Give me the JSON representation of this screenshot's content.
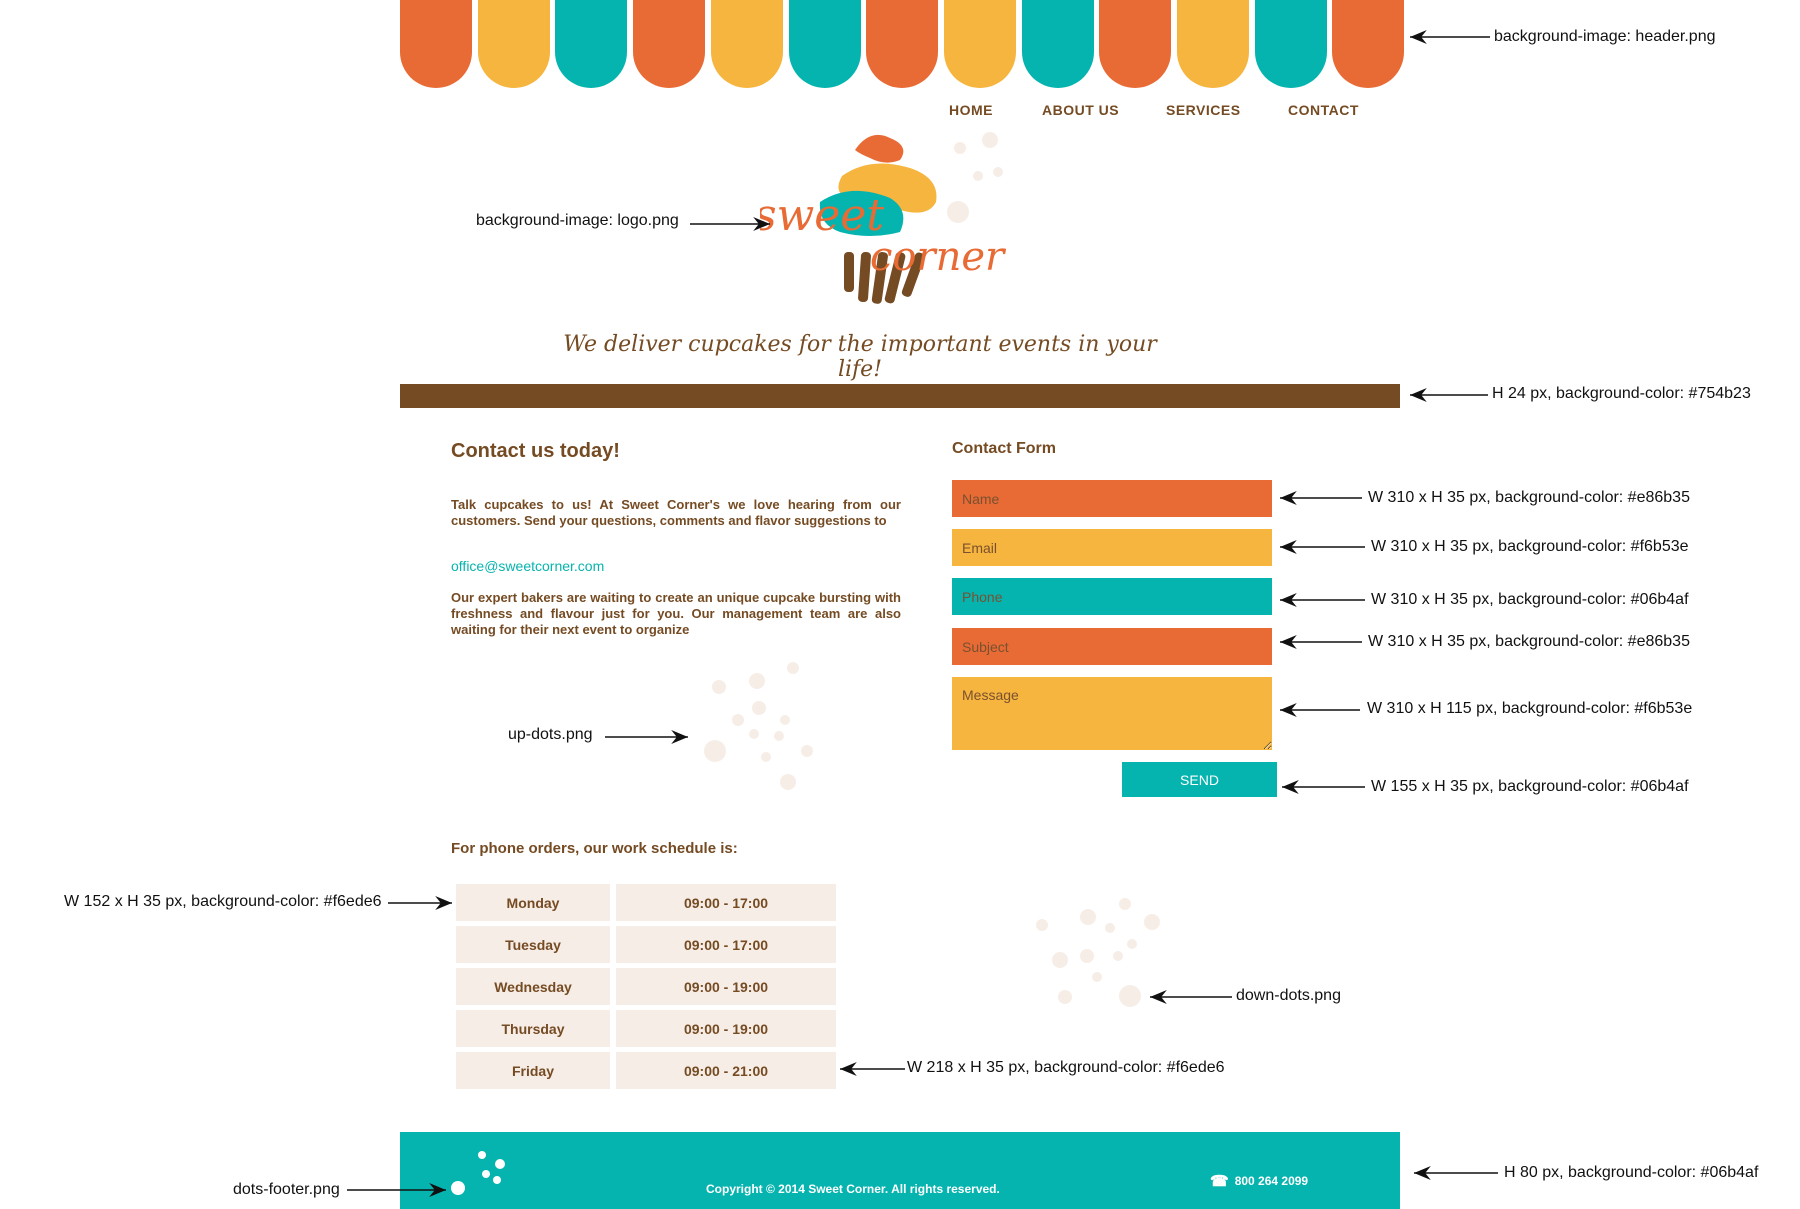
{
  "header": {
    "stripe_colors": [
      "#e86b35",
      "#f6b53e",
      "#06b4af",
      "#e86b35",
      "#f6b53e",
      "#06b4af",
      "#e86b35",
      "#f6b53e",
      "#06b4af",
      "#e86b35",
      "#f6b53e",
      "#06b4af",
      "#e86b35"
    ]
  },
  "nav": {
    "home": "HOME",
    "about": "ABOUT US",
    "services": "SERVICES",
    "contact": "CONTACT"
  },
  "logo": {
    "line1": "sweet",
    "line2": "corner"
  },
  "tagline": "We deliver cupcakes for the important events in your life!",
  "contact": {
    "heading": "Contact us today!",
    "paragraph1": "Talk cupcakes to us! At Sweet Corner's we love hearing from our customers. Send your questions, comments and flavor suggestions to",
    "email": "office@sweetcorner.com",
    "paragraph2": "Our expert bakers are waiting to create an unique cupcake bursting with freshness and flavour just for you. Our management team are also waiting for their next event to organize"
  },
  "form": {
    "title": "Contact Form",
    "name_placeholder": "Name",
    "email_placeholder": "Email",
    "phone_placeholder": "Phone",
    "subject_placeholder": "Subject",
    "message_placeholder": "Message",
    "send_label": "SEND"
  },
  "schedule": {
    "heading": "For phone orders, our work schedule is:",
    "rows": [
      {
        "day": "Monday",
        "hours": "09:00 - 17:00"
      },
      {
        "day": "Tuesday",
        "hours": "09:00 - 17:00"
      },
      {
        "day": "Wednesday",
        "hours": "09:00 - 19:00"
      },
      {
        "day": "Thursday",
        "hours": "09:00 - 19:00"
      },
      {
        "day": "Friday",
        "hours": "09:00 - 21:00"
      }
    ]
  },
  "footer": {
    "copyright": "Copyright © 2014 Sweet Corner. All rights reserved.",
    "phone": "800 264 2099"
  },
  "annotations": {
    "header": "background-image: header.png",
    "logo": "background-image: logo.png",
    "bar": "H 24 px, background-color: #754b23",
    "name": "W 310 x H 35 px, background-color: #e86b35",
    "email": "W 310 x H 35 px, background-color: #f6b53e",
    "phone": "W 310 x H 35 px, background-color: #06b4af",
    "subject": "W 310 x H 35 px, background-color: #e86b35",
    "message": "W 310 x H 115 px, background-color: #f6b53e",
    "send": "W 155 x H 35 px, background-color: #06b4af",
    "updots": "up-dots.png",
    "daycell": "W 152 x H 35 px, background-color: #f6ede6",
    "downdots": "down-dots.png",
    "hourscell": "W 218 x H 35 px, background-color: #f6ede6",
    "dotsfooter": "dots-footer.png",
    "footer": "H 80 px, background-color: #06b4af"
  },
  "colors": {
    "orange": "#e86b35",
    "yellow": "#f6b53e",
    "teal": "#06b4af",
    "brown": "#754b23",
    "cream": "#f6ede6"
  }
}
